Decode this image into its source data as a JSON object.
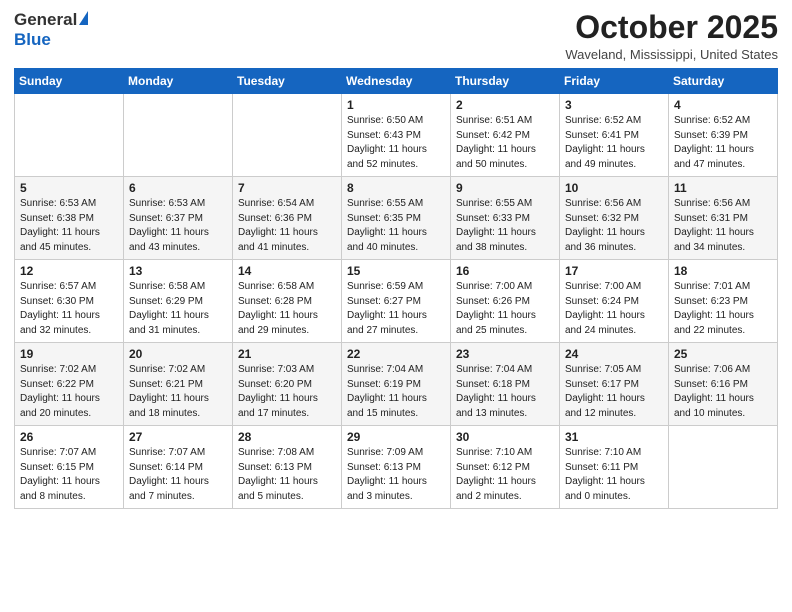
{
  "logo": {
    "general": "General",
    "blue": "Blue"
  },
  "title": "October 2025",
  "location": "Waveland, Mississippi, United States",
  "weekdays": [
    "Sunday",
    "Monday",
    "Tuesday",
    "Wednesday",
    "Thursday",
    "Friday",
    "Saturday"
  ],
  "weeks": [
    [
      {
        "num": "",
        "info": ""
      },
      {
        "num": "",
        "info": ""
      },
      {
        "num": "",
        "info": ""
      },
      {
        "num": "1",
        "info": "Sunrise: 6:50 AM\nSunset: 6:43 PM\nDaylight: 11 hours\nand 52 minutes."
      },
      {
        "num": "2",
        "info": "Sunrise: 6:51 AM\nSunset: 6:42 PM\nDaylight: 11 hours\nand 50 minutes."
      },
      {
        "num": "3",
        "info": "Sunrise: 6:52 AM\nSunset: 6:41 PM\nDaylight: 11 hours\nand 49 minutes."
      },
      {
        "num": "4",
        "info": "Sunrise: 6:52 AM\nSunset: 6:39 PM\nDaylight: 11 hours\nand 47 minutes."
      }
    ],
    [
      {
        "num": "5",
        "info": "Sunrise: 6:53 AM\nSunset: 6:38 PM\nDaylight: 11 hours\nand 45 minutes."
      },
      {
        "num": "6",
        "info": "Sunrise: 6:53 AM\nSunset: 6:37 PM\nDaylight: 11 hours\nand 43 minutes."
      },
      {
        "num": "7",
        "info": "Sunrise: 6:54 AM\nSunset: 6:36 PM\nDaylight: 11 hours\nand 41 minutes."
      },
      {
        "num": "8",
        "info": "Sunrise: 6:55 AM\nSunset: 6:35 PM\nDaylight: 11 hours\nand 40 minutes."
      },
      {
        "num": "9",
        "info": "Sunrise: 6:55 AM\nSunset: 6:33 PM\nDaylight: 11 hours\nand 38 minutes."
      },
      {
        "num": "10",
        "info": "Sunrise: 6:56 AM\nSunset: 6:32 PM\nDaylight: 11 hours\nand 36 minutes."
      },
      {
        "num": "11",
        "info": "Sunrise: 6:56 AM\nSunset: 6:31 PM\nDaylight: 11 hours\nand 34 minutes."
      }
    ],
    [
      {
        "num": "12",
        "info": "Sunrise: 6:57 AM\nSunset: 6:30 PM\nDaylight: 11 hours\nand 32 minutes."
      },
      {
        "num": "13",
        "info": "Sunrise: 6:58 AM\nSunset: 6:29 PM\nDaylight: 11 hours\nand 31 minutes."
      },
      {
        "num": "14",
        "info": "Sunrise: 6:58 AM\nSunset: 6:28 PM\nDaylight: 11 hours\nand 29 minutes."
      },
      {
        "num": "15",
        "info": "Sunrise: 6:59 AM\nSunset: 6:27 PM\nDaylight: 11 hours\nand 27 minutes."
      },
      {
        "num": "16",
        "info": "Sunrise: 7:00 AM\nSunset: 6:26 PM\nDaylight: 11 hours\nand 25 minutes."
      },
      {
        "num": "17",
        "info": "Sunrise: 7:00 AM\nSunset: 6:24 PM\nDaylight: 11 hours\nand 24 minutes."
      },
      {
        "num": "18",
        "info": "Sunrise: 7:01 AM\nSunset: 6:23 PM\nDaylight: 11 hours\nand 22 minutes."
      }
    ],
    [
      {
        "num": "19",
        "info": "Sunrise: 7:02 AM\nSunset: 6:22 PM\nDaylight: 11 hours\nand 20 minutes."
      },
      {
        "num": "20",
        "info": "Sunrise: 7:02 AM\nSunset: 6:21 PM\nDaylight: 11 hours\nand 18 minutes."
      },
      {
        "num": "21",
        "info": "Sunrise: 7:03 AM\nSunset: 6:20 PM\nDaylight: 11 hours\nand 17 minutes."
      },
      {
        "num": "22",
        "info": "Sunrise: 7:04 AM\nSunset: 6:19 PM\nDaylight: 11 hours\nand 15 minutes."
      },
      {
        "num": "23",
        "info": "Sunrise: 7:04 AM\nSunset: 6:18 PM\nDaylight: 11 hours\nand 13 minutes."
      },
      {
        "num": "24",
        "info": "Sunrise: 7:05 AM\nSunset: 6:17 PM\nDaylight: 11 hours\nand 12 minutes."
      },
      {
        "num": "25",
        "info": "Sunrise: 7:06 AM\nSunset: 6:16 PM\nDaylight: 11 hours\nand 10 minutes."
      }
    ],
    [
      {
        "num": "26",
        "info": "Sunrise: 7:07 AM\nSunset: 6:15 PM\nDaylight: 11 hours\nand 8 minutes."
      },
      {
        "num": "27",
        "info": "Sunrise: 7:07 AM\nSunset: 6:14 PM\nDaylight: 11 hours\nand 7 minutes."
      },
      {
        "num": "28",
        "info": "Sunrise: 7:08 AM\nSunset: 6:13 PM\nDaylight: 11 hours\nand 5 minutes."
      },
      {
        "num": "29",
        "info": "Sunrise: 7:09 AM\nSunset: 6:13 PM\nDaylight: 11 hours\nand 3 minutes."
      },
      {
        "num": "30",
        "info": "Sunrise: 7:10 AM\nSunset: 6:12 PM\nDaylight: 11 hours\nand 2 minutes."
      },
      {
        "num": "31",
        "info": "Sunrise: 7:10 AM\nSunset: 6:11 PM\nDaylight: 11 hours\nand 0 minutes."
      },
      {
        "num": "",
        "info": ""
      }
    ]
  ]
}
